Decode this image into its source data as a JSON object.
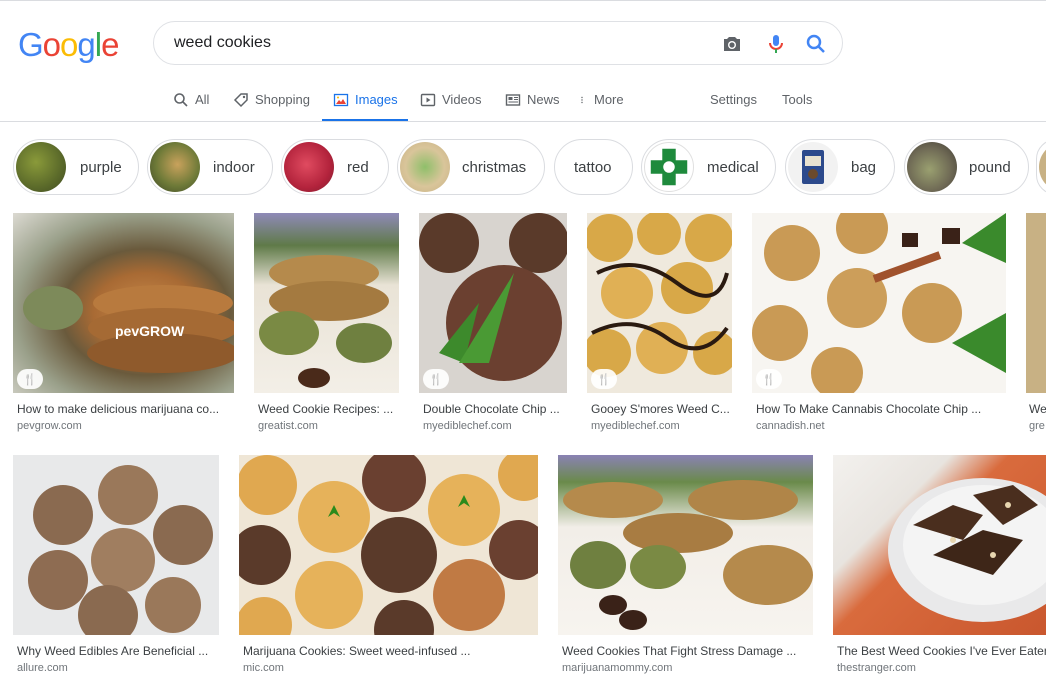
{
  "logo": {
    "g1": "G",
    "o1": "o",
    "o2": "o",
    "g2": "g",
    "l": "l",
    "e": "e"
  },
  "search": {
    "query": "weed cookies"
  },
  "icons": {
    "camera": "camera-icon",
    "mic": "microphone-icon",
    "search": "search-icon"
  },
  "tabs": [
    {
      "label": "All"
    },
    {
      "label": "Shopping"
    },
    {
      "label": "Images"
    },
    {
      "label": "Videos"
    },
    {
      "label": "News"
    },
    {
      "label": "More"
    }
  ],
  "tools": {
    "settings": "Settings",
    "tools": "Tools"
  },
  "colors": {
    "accent": "#1a73e8",
    "blue": "#4285f4",
    "red": "#ea4335",
    "yellow": "#fbbc05",
    "green": "#34a853"
  },
  "chips": [
    {
      "label": "purple"
    },
    {
      "label": "indoor"
    },
    {
      "label": "red"
    },
    {
      "label": "christmas"
    },
    {
      "label": "tattoo"
    },
    {
      "label": "medical"
    },
    {
      "label": "bag"
    },
    {
      "label": "pound"
    }
  ],
  "results_row1": [
    {
      "title": "How to make delicious marijuana co...",
      "source": "pevgrow.com",
      "watermark": "pevGROW"
    },
    {
      "title": "Weed Cookie Recipes: ...",
      "source": "greatist.com"
    },
    {
      "title": "Double Chocolate Chip ...",
      "source": "myediblechef.com"
    },
    {
      "title": "Gooey S'mores Weed C...",
      "source": "myediblechef.com"
    },
    {
      "title": "How To Make Cannabis Chocolate Chip ...",
      "source": "cannadish.net"
    },
    {
      "title": "We",
      "source": "gre"
    }
  ],
  "results_row2": [
    {
      "title": "Why Weed Edibles Are Beneficial ...",
      "source": "allure.com"
    },
    {
      "title": "Marijuana Cookies: Sweet weed-infused ...",
      "source": "mic.com"
    },
    {
      "title": "Weed Cookies That Fight Stress Damage ...",
      "source": "marijuanamommy.com"
    },
    {
      "title": "The Best Weed Cookies I've Ever Eaten",
      "source": "thestranger.com"
    }
  ]
}
